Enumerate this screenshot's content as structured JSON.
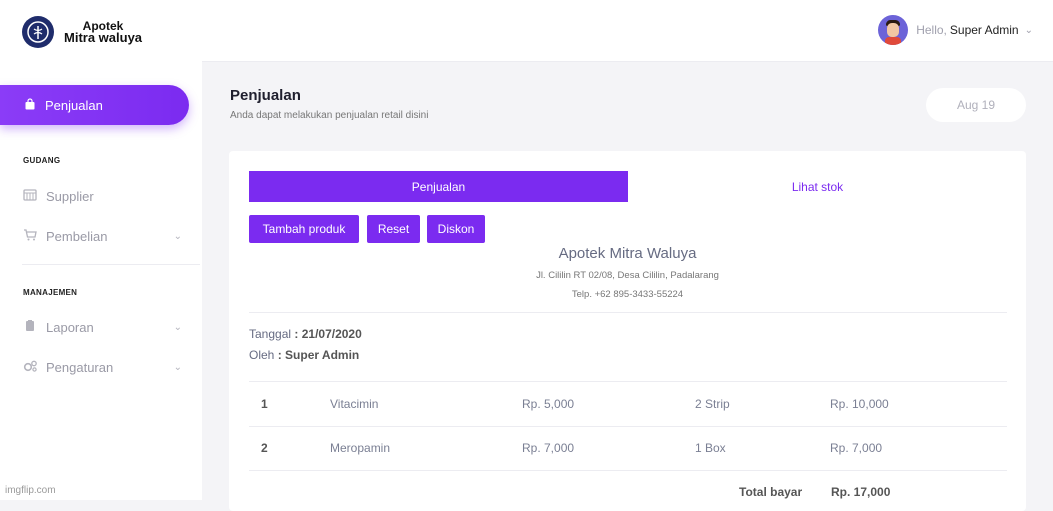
{
  "brand": {
    "line1": "Apotek",
    "line2": "Mitra waluya"
  },
  "sidebar": {
    "active_item": "Penjualan",
    "sections": [
      {
        "label": "GUDANG",
        "items": [
          {
            "label": "Supplier",
            "icon": "server-icon"
          },
          {
            "label": "Pembelian",
            "icon": "cart-icon"
          }
        ]
      },
      {
        "label": "MANAJEMEN",
        "items": [
          {
            "label": "Laporan",
            "icon": "clipboard-icon"
          },
          {
            "label": "Pengaturan",
            "icon": "gears-icon"
          }
        ]
      }
    ]
  },
  "topbar": {
    "hello": "Hello,",
    "username": "Super Admin"
  },
  "page": {
    "title": "Penjualan",
    "subtitle": "Anda dapat melakukan penjualan retail disini",
    "date": "Aug 19"
  },
  "tabs": [
    "Penjualan",
    "Lihat stok"
  ],
  "buttons": {
    "add": "Tambah produk",
    "reset": "Reset",
    "discount": "Diskon"
  },
  "store": {
    "name": "Apotek Mitra Waluya",
    "address": "Jl. Cililin RT 02/08, Desa Cililin, Padalarang",
    "phone": "Telp. +62 895-3433-55224"
  },
  "meta": {
    "date_label": "Tanggal",
    "date_value": ": 21/07/2020",
    "by_label": "Oleh",
    "by_value": ": Super Admin"
  },
  "items": [
    {
      "no": "1",
      "name": "Vitacimin",
      "price": "Rp. 5,000",
      "qty": "2 Strip",
      "subtotal": "Rp. 10,000"
    },
    {
      "no": "2",
      "name": "Meropamin",
      "price": "Rp. 7,000",
      "qty": "1 Box",
      "subtotal": "Rp. 7,000"
    }
  ],
  "total": {
    "label": "Total bayar",
    "value": "Rp. 17,000"
  },
  "watermark": "imgflip.com",
  "colors": {
    "accent": "#7b2bf0"
  }
}
